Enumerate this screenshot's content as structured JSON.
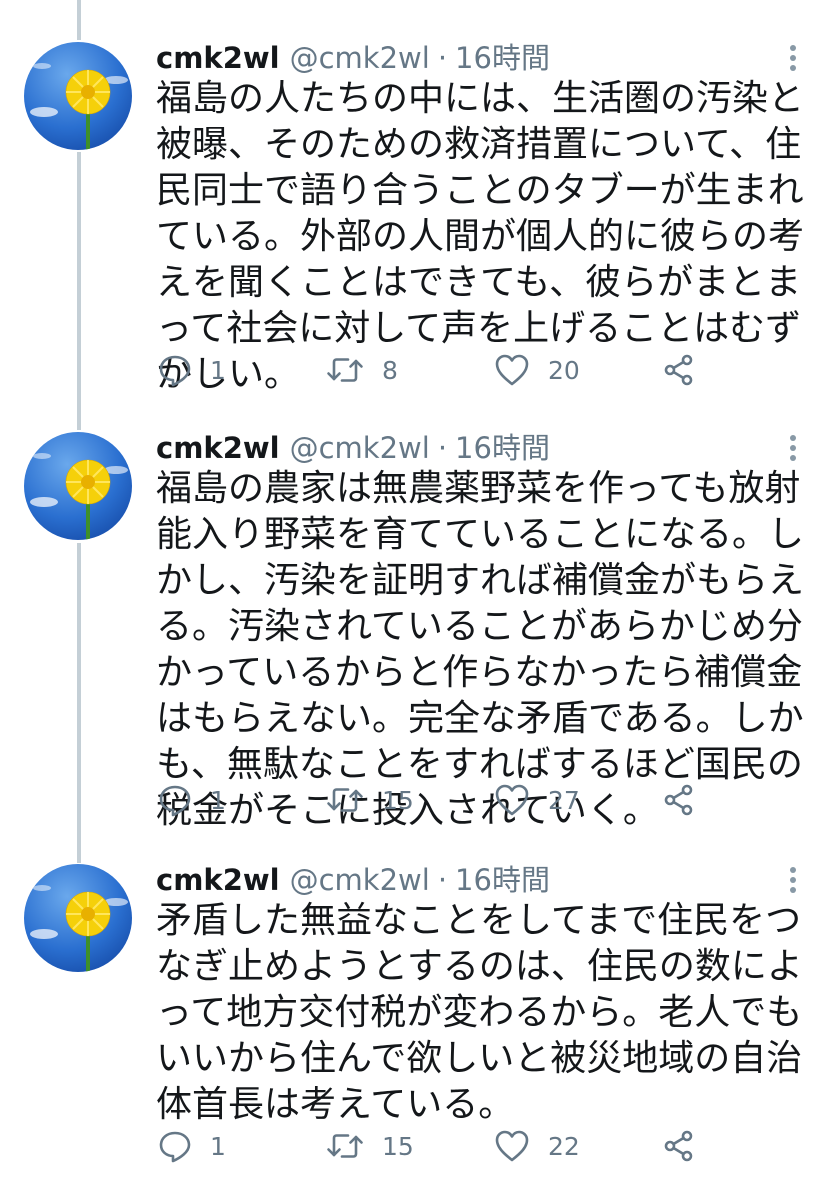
{
  "tweets": [
    {
      "name": "cmk2wl",
      "handle": "@cmk2wl",
      "separator": "·",
      "time": "16時間",
      "text": "福島の人たちの中には、生活圏の汚染と被曝、そのための救済措置について、住民同士で語り合うことのタブーが生まれている。外部の人間が個人的に彼らの考えを聞くことはできても、彼らがまとまって社会に対して声を上げることはむずかしい。",
      "replies": "1",
      "retweets": "8",
      "likes": "20"
    },
    {
      "name": "cmk2wl",
      "handle": "@cmk2wl",
      "separator": "·",
      "time": "16時間",
      "text": "福島の農家は無農薬野菜を作っても放射能入り野菜を育てていることになる。しかし、汚染を証明すれば補償金がもらえる。汚染されていることがあらかじめ分かっているからと作らなかったら補償金はもらえない。完全な矛盾である。しかも、無駄なことをすればするほど国民の税金がそこに投入されていく。",
      "replies": "1",
      "retweets": "15",
      "likes": "27"
    },
    {
      "name": "cmk2wl",
      "handle": "@cmk2wl",
      "separator": "·",
      "time": "16時間",
      "text": "矛盾した無益なことをしてまで住民をつなぎ止めようとするのは、住民の数によって地方交付税が変わるから。老人でもいいから住んで欲しいと被災地域の自治体首長は考えている。",
      "replies": "1",
      "retweets": "15",
      "likes": "22"
    }
  ],
  "icons": {
    "reply": "reply-icon",
    "retweet": "retweet-icon",
    "like": "heart-icon",
    "share": "share-icon",
    "more": "more-vertical-icon",
    "avatar": "dandelion-avatar"
  },
  "colors": {
    "text": "#14171a",
    "secondary": "#657786",
    "thread_line": "#c4cfd6",
    "avatar_sky": "#1f5fc4",
    "avatar_flower": "#f5d00a"
  }
}
